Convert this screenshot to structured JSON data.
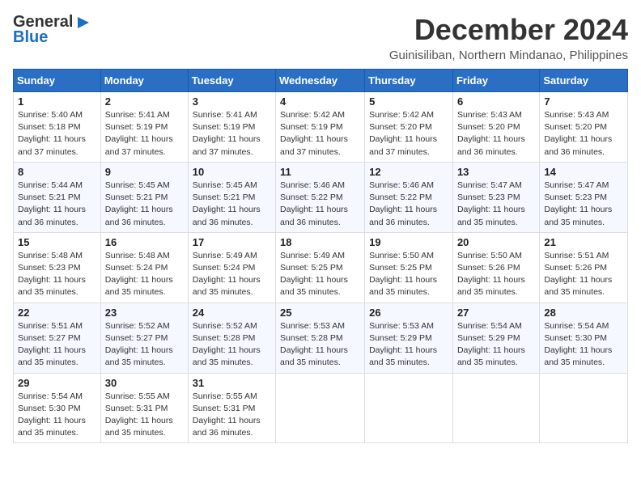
{
  "logo": {
    "line1": "General",
    "line2": "Blue",
    "arrow_unicode": "▶"
  },
  "title": "December 2024",
  "subtitle": "Guinisiliban, Northern Mindanao, Philippines",
  "days_of_week": [
    "Sunday",
    "Monday",
    "Tuesday",
    "Wednesday",
    "Thursday",
    "Friday",
    "Saturday"
  ],
  "weeks": [
    [
      {
        "day": "1",
        "info": "Sunrise: 5:40 AM\nSunset: 5:18 PM\nDaylight: 11 hours\nand 37 minutes."
      },
      {
        "day": "2",
        "info": "Sunrise: 5:41 AM\nSunset: 5:19 PM\nDaylight: 11 hours\nand 37 minutes."
      },
      {
        "day": "3",
        "info": "Sunrise: 5:41 AM\nSunset: 5:19 PM\nDaylight: 11 hours\nand 37 minutes."
      },
      {
        "day": "4",
        "info": "Sunrise: 5:42 AM\nSunset: 5:19 PM\nDaylight: 11 hours\nand 37 minutes."
      },
      {
        "day": "5",
        "info": "Sunrise: 5:42 AM\nSunset: 5:20 PM\nDaylight: 11 hours\nand 37 minutes."
      },
      {
        "day": "6",
        "info": "Sunrise: 5:43 AM\nSunset: 5:20 PM\nDaylight: 11 hours\nand 36 minutes."
      },
      {
        "day": "7",
        "info": "Sunrise: 5:43 AM\nSunset: 5:20 PM\nDaylight: 11 hours\nand 36 minutes."
      }
    ],
    [
      {
        "day": "8",
        "info": "Sunrise: 5:44 AM\nSunset: 5:21 PM\nDaylight: 11 hours\nand 36 minutes."
      },
      {
        "day": "9",
        "info": "Sunrise: 5:45 AM\nSunset: 5:21 PM\nDaylight: 11 hours\nand 36 minutes."
      },
      {
        "day": "10",
        "info": "Sunrise: 5:45 AM\nSunset: 5:21 PM\nDaylight: 11 hours\nand 36 minutes."
      },
      {
        "day": "11",
        "info": "Sunrise: 5:46 AM\nSunset: 5:22 PM\nDaylight: 11 hours\nand 36 minutes."
      },
      {
        "day": "12",
        "info": "Sunrise: 5:46 AM\nSunset: 5:22 PM\nDaylight: 11 hours\nand 36 minutes."
      },
      {
        "day": "13",
        "info": "Sunrise: 5:47 AM\nSunset: 5:23 PM\nDaylight: 11 hours\nand 35 minutes."
      },
      {
        "day": "14",
        "info": "Sunrise: 5:47 AM\nSunset: 5:23 PM\nDaylight: 11 hours\nand 35 minutes."
      }
    ],
    [
      {
        "day": "15",
        "info": "Sunrise: 5:48 AM\nSunset: 5:23 PM\nDaylight: 11 hours\nand 35 minutes."
      },
      {
        "day": "16",
        "info": "Sunrise: 5:48 AM\nSunset: 5:24 PM\nDaylight: 11 hours\nand 35 minutes."
      },
      {
        "day": "17",
        "info": "Sunrise: 5:49 AM\nSunset: 5:24 PM\nDaylight: 11 hours\nand 35 minutes."
      },
      {
        "day": "18",
        "info": "Sunrise: 5:49 AM\nSunset: 5:25 PM\nDaylight: 11 hours\nand 35 minutes."
      },
      {
        "day": "19",
        "info": "Sunrise: 5:50 AM\nSunset: 5:25 PM\nDaylight: 11 hours\nand 35 minutes."
      },
      {
        "day": "20",
        "info": "Sunrise: 5:50 AM\nSunset: 5:26 PM\nDaylight: 11 hours\nand 35 minutes."
      },
      {
        "day": "21",
        "info": "Sunrise: 5:51 AM\nSunset: 5:26 PM\nDaylight: 11 hours\nand 35 minutes."
      }
    ],
    [
      {
        "day": "22",
        "info": "Sunrise: 5:51 AM\nSunset: 5:27 PM\nDaylight: 11 hours\nand 35 minutes."
      },
      {
        "day": "23",
        "info": "Sunrise: 5:52 AM\nSunset: 5:27 PM\nDaylight: 11 hours\nand 35 minutes."
      },
      {
        "day": "24",
        "info": "Sunrise: 5:52 AM\nSunset: 5:28 PM\nDaylight: 11 hours\nand 35 minutes."
      },
      {
        "day": "25",
        "info": "Sunrise: 5:53 AM\nSunset: 5:28 PM\nDaylight: 11 hours\nand 35 minutes."
      },
      {
        "day": "26",
        "info": "Sunrise: 5:53 AM\nSunset: 5:29 PM\nDaylight: 11 hours\nand 35 minutes."
      },
      {
        "day": "27",
        "info": "Sunrise: 5:54 AM\nSunset: 5:29 PM\nDaylight: 11 hours\nand 35 minutes."
      },
      {
        "day": "28",
        "info": "Sunrise: 5:54 AM\nSunset: 5:30 PM\nDaylight: 11 hours\nand 35 minutes."
      }
    ],
    [
      {
        "day": "29",
        "info": "Sunrise: 5:54 AM\nSunset: 5:30 PM\nDaylight: 11 hours\nand 35 minutes."
      },
      {
        "day": "30",
        "info": "Sunrise: 5:55 AM\nSunset: 5:31 PM\nDaylight: 11 hours\nand 35 minutes."
      },
      {
        "day": "31",
        "info": "Sunrise: 5:55 AM\nSunset: 5:31 PM\nDaylight: 11 hours\nand 36 minutes."
      },
      null,
      null,
      null,
      null
    ]
  ]
}
